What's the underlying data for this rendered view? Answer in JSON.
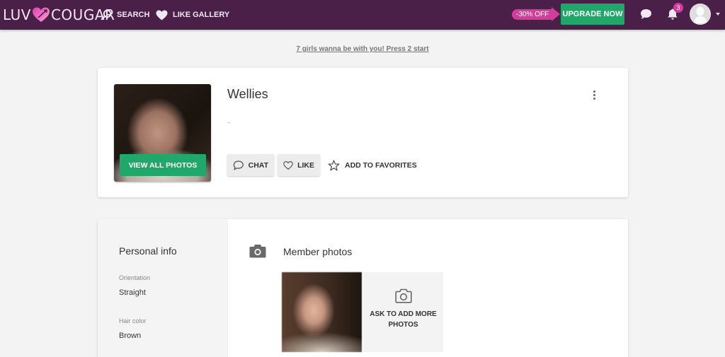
{
  "header": {
    "logo_left": "LUV",
    "logo_right": "COUGAR",
    "nav": [
      {
        "label": "SEARCH",
        "icon": "search-icon"
      },
      {
        "label": "LIKE GALLERY",
        "icon": "heart-icon"
      }
    ],
    "promo_label": "-30% OFF",
    "upgrade_label": "UPGRADE NOW",
    "notification_count": "3",
    "colors": {
      "bar": "#4a1f48",
      "accent_pink": "#d33c9a",
      "accent_green": "#1fa86a"
    }
  },
  "teaser": {
    "text": "7 girls wanna be with you! Press 2 start"
  },
  "profile": {
    "name": "Wellies",
    "view_all_photos_label": "VIEW ALL PHOTOS",
    "actions": {
      "chat_label": "CHAT",
      "like_label": "LIKE",
      "favorites_label": "ADD TO FAVORITES"
    }
  },
  "personal_info": {
    "title": "Personal info",
    "fields": [
      {
        "label": "Orientation",
        "value": "Straight"
      },
      {
        "label": "Hair color",
        "value": "Brown"
      }
    ]
  },
  "member_photos": {
    "title": "Member photos",
    "ask_label": "ASK TO ADD MORE PHOTOS"
  }
}
